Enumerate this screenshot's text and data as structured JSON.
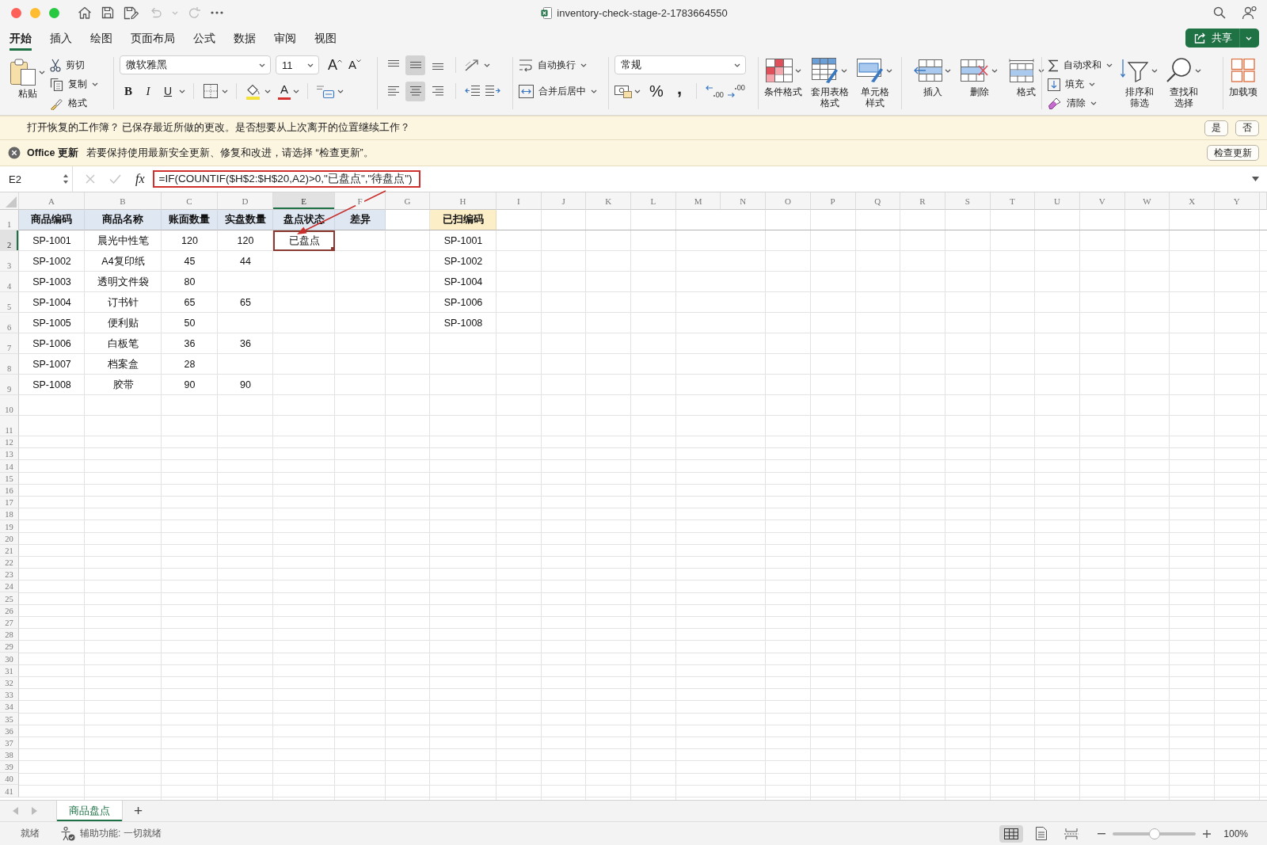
{
  "window": {
    "title": "inventory-check-stage-2-1783664550"
  },
  "quick_access": [
    {
      "kind": "home",
      "disabled": false
    },
    {
      "kind": "save",
      "disabled": false
    },
    {
      "kind": "save_edit",
      "disabled": false
    },
    {
      "kind": "undo",
      "disabled": true
    },
    {
      "kind": "redo",
      "disabled": true
    }
  ],
  "ribbon_tabs": [
    {
      "label": "开始",
      "selected": true
    },
    {
      "label": "插入",
      "selected": false
    },
    {
      "label": "绘图",
      "selected": false
    },
    {
      "label": "页面布局",
      "selected": false
    },
    {
      "label": "公式",
      "selected": false
    },
    {
      "label": "数据",
      "selected": false
    },
    {
      "label": "审阅",
      "selected": false
    },
    {
      "label": "视图",
      "selected": false
    }
  ],
  "share_button": {
    "label": "共享"
  },
  "ribbon": {
    "clipboard": {
      "paste": "粘贴",
      "cut": "剪切",
      "copy": "复制",
      "format_painter": "格式"
    },
    "font": {
      "name": "微软雅黑",
      "size": "11",
      "grow": "A",
      "shrink": "A",
      "bold": "B",
      "italic": "I",
      "underline": "U",
      "font_color": "A"
    },
    "alignment": {
      "vertical": [
        {
          "kind": "top",
          "selected": false
        },
        {
          "kind": "middle",
          "selected": true
        },
        {
          "kind": "bottom",
          "selected": false
        }
      ],
      "horizontal": [
        {
          "kind": "left",
          "selected": false
        },
        {
          "kind": "center",
          "selected": true
        },
        {
          "kind": "right",
          "selected": false
        }
      ]
    },
    "wrap_text": "自动换行",
    "merge_center": "合并后居中",
    "number": {
      "format": "常规",
      "percent": "%",
      "comma": ","
    },
    "styles": [
      {
        "kind": "conditional",
        "label": "条件格式"
      },
      {
        "kind": "table",
        "label": "套用表格格式"
      },
      {
        "kind": "cell",
        "label": "单元格样式"
      }
    ],
    "cells": [
      {
        "kind": "insert",
        "label": "插入"
      },
      {
        "kind": "delete",
        "label": "删除"
      },
      {
        "kind": "format",
        "label": "格式"
      }
    ],
    "editing": [
      {
        "kind": "autosum",
        "label": "自动求和"
      },
      {
        "kind": "fill",
        "label": "填充"
      },
      {
        "kind": "clear",
        "label": "清除"
      }
    ],
    "sort_find": [
      {
        "kind": "sort_filter",
        "label": "排序和筛选"
      },
      {
        "kind": "find_select",
        "label": "查找和选择"
      }
    ],
    "add_ins": {
      "label": "加载项"
    }
  },
  "recovery_bar": {
    "message": "打开恢复的工作簿？ 已保存最近所做的更改。是否想要从上次离开的位置继续工作？",
    "buttons": [
      "是",
      "否"
    ]
  },
  "update_bar": {
    "title": "Office 更新",
    "message": "若要保持使用最新安全更新、修复和改进，请选择 “检查更新”。",
    "button": "检查更新"
  },
  "formula_bar": {
    "name_box": "E2",
    "buttons": [
      {
        "kind": "cancel",
        "disabled": true
      },
      {
        "kind": "enter",
        "disabled": true
      }
    ],
    "function_label": "fx",
    "formula": "=IF(COUNTIF($H$2:$H$20,A2)>0,\"已盘点\",\"待盘点\")"
  },
  "sheet": {
    "column_headers": [
      {
        "label": "A",
        "selected": false
      },
      {
        "label": "B",
        "selected": false
      },
      {
        "label": "C",
        "selected": false
      },
      {
        "label": "D",
        "selected": false
      },
      {
        "label": "E",
        "selected": true
      },
      {
        "label": "F",
        "selected": false
      },
      {
        "label": "G",
        "selected": false
      },
      {
        "label": "H",
        "selected": false
      },
      {
        "label": "I",
        "selected": false
      },
      {
        "label": "J",
        "selected": false
      },
      {
        "label": "K",
        "selected": false
      },
      {
        "label": "L",
        "selected": false
      },
      {
        "label": "M",
        "selected": false
      },
      {
        "label": "N",
        "selected": false
      },
      {
        "label": "O",
        "selected": false
      },
      {
        "label": "P",
        "selected": false
      },
      {
        "label": "Q",
        "selected": false
      },
      {
        "label": "R",
        "selected": false
      },
      {
        "label": "S",
        "selected": false
      },
      {
        "label": "T",
        "selected": false
      },
      {
        "label": "U",
        "selected": false
      },
      {
        "label": "V",
        "selected": false
      },
      {
        "label": "W",
        "selected": false
      },
      {
        "label": "X",
        "selected": false
      },
      {
        "label": "Y",
        "selected": false
      }
    ],
    "row_headers": [
      {
        "label": "1",
        "selected": false
      },
      {
        "label": "2",
        "selected": true
      },
      {
        "label": "3",
        "selected": false
      },
      {
        "label": "4",
        "selected": false
      },
      {
        "label": "5",
        "selected": false
      },
      {
        "label": "6",
        "selected": false
      },
      {
        "label": "7",
        "selected": false
      },
      {
        "label": "8",
        "selected": false
      },
      {
        "label": "9",
        "selected": false
      },
      {
        "label": "10",
        "selected": false
      },
      {
        "label": "11",
        "selected": false
      },
      {
        "label": "12",
        "selected": false
      },
      {
        "label": "13",
        "selected": false
      },
      {
        "label": "14",
        "selected": false
      },
      {
        "label": "15",
        "selected": false
      },
      {
        "label": "16",
        "selected": false
      },
      {
        "label": "17",
        "selected": false
      },
      {
        "label": "18",
        "selected": false
      },
      {
        "label": "19",
        "selected": false
      },
      {
        "label": "20",
        "selected": false
      },
      {
        "label": "21",
        "selected": false
      },
      {
        "label": "22",
        "selected": false
      },
      {
        "label": "23",
        "selected": false
      },
      {
        "label": "24",
        "selected": false
      },
      {
        "label": "25",
        "selected": false
      },
      {
        "label": "26",
        "selected": false
      },
      {
        "label": "27",
        "selected": false
      },
      {
        "label": "28",
        "selected": false
      },
      {
        "label": "29",
        "selected": false
      },
      {
        "label": "30",
        "selected": false
      },
      {
        "label": "31",
        "selected": false
      },
      {
        "label": "32",
        "selected": false
      },
      {
        "label": "33",
        "selected": false
      },
      {
        "label": "34",
        "selected": false
      },
      {
        "label": "35",
        "selected": false
      },
      {
        "label": "36",
        "selected": false
      },
      {
        "label": "37",
        "selected": false
      },
      {
        "label": "38",
        "selected": false
      },
      {
        "label": "39",
        "selected": false
      },
      {
        "label": "40",
        "selected": false
      },
      {
        "label": "41",
        "selected": false
      }
    ],
    "inventory_table": {
      "columns": [
        "商品编码",
        "商品名称",
        "账面数量",
        "实盘数量",
        "盘点状态",
        "差异"
      ],
      "rows": [
        {
          "code": "SP-1001",
          "name": "晨光中性笔",
          "book_qty": "120",
          "counted_qty": "120",
          "status": "已盘点"
        },
        {
          "code": "SP-1002",
          "name": "A4复印纸",
          "book_qty": "45",
          "counted_qty": "44"
        },
        {
          "code": "SP-1003",
          "name": "透明文件袋",
          "book_qty": "80"
        },
        {
          "code": "SP-1004",
          "name": "订书针",
          "book_qty": "65",
          "counted_qty": "65"
        },
        {
          "code": "SP-1005",
          "name": "便利贴",
          "book_qty": "50"
        },
        {
          "code": "SP-1006",
          "name": "白板笔",
          "book_qty": "36",
          "counted_qty": "36"
        },
        {
          "code": "SP-1007",
          "name": "档案盒",
          "book_qty": "28"
        },
        {
          "code": "SP-1008",
          "name": "胶带",
          "book_qty": "90",
          "counted_qty": "90"
        }
      ]
    },
    "scanned_table": {
      "column": "已扫编码",
      "rows": [
        "SP-1001",
        "SP-1002",
        "SP-1004",
        "SP-1006",
        "SP-1008"
      ]
    }
  },
  "sheet_tabs": {
    "nav": [
      {
        "kind": "previous",
        "disabled": true
      },
      {
        "kind": "next",
        "disabled": true
      }
    ],
    "tabs": [
      {
        "label": "商品盘点",
        "selected": true
      }
    ],
    "add": "+"
  },
  "status_bar": {
    "ready": "就绪",
    "accessibility": "辅助功能: 一切就绪",
    "views": [
      {
        "kind": "normal",
        "selected": true
      },
      {
        "kind": "page_layout",
        "selected": false
      },
      {
        "kind": "page_break",
        "selected": false
      }
    ],
    "zoom": {
      "level": 0.5,
      "reading": "100%"
    }
  }
}
